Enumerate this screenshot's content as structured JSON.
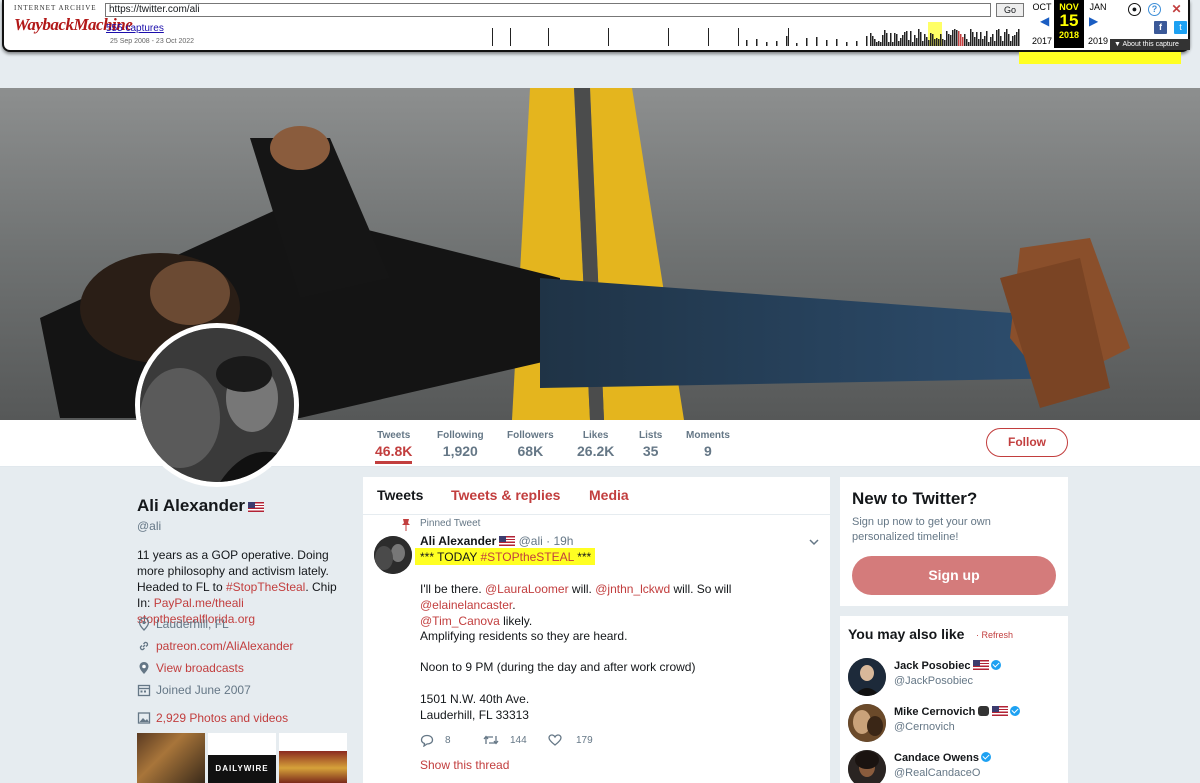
{
  "wayback": {
    "logo_top": "INTERNET ARCHIVE",
    "logo_main": "WaybackMachine",
    "url": "https://twitter.com/ali",
    "go_label": "Go",
    "captures": "555 captures",
    "range": "25 Sep 2008 - 23 Oct 2022",
    "prev_month": "OCT",
    "cur_month": "NOV",
    "cur_day": "15",
    "cur_year": "2018",
    "next_month": "JAN",
    "prev_year": "2017",
    "next_year": "2019",
    "about": "About this capture"
  },
  "profile": {
    "name": "Ali Alexander",
    "handle": "@ali",
    "bio_line1": "11 years as a GOP operative. Doing more philosophy and activism lately. Headed to FL to ",
    "bio_tag": "#StopTheSteal",
    "bio_line2": ". Chip In: ",
    "bio_links": "PayPal.me/theali stopthestealflorida.org",
    "location": "Lauderhill, FL",
    "website": "patreon.com/AliAlexander",
    "broadcasts": "View broadcasts",
    "joined": "Joined June 2007",
    "photos": "2,929 Photos and videos",
    "photo_thumb2_text": "DAILYWIRE"
  },
  "stats": [
    {
      "label": "Tweets",
      "value": "46.8K"
    },
    {
      "label": "Following",
      "value": "1,920"
    },
    {
      "label": "Followers",
      "value": "68K"
    },
    {
      "label": "Likes",
      "value": "26.2K"
    },
    {
      "label": "Lists",
      "value": "35"
    },
    {
      "label": "Moments",
      "value": "9"
    }
  ],
  "follow_label": "Follow",
  "tabs": [
    "Tweets",
    "Tweets & replies",
    "Media"
  ],
  "tweet": {
    "pinned": "Pinned Tweet",
    "name": "Ali Alexander",
    "handle": "@ali",
    "time": "· 19h",
    "line1_a": "*** TODAY ",
    "line1_tag": "#STOPtheSTEAL",
    "line1_b": " ***",
    "p1_a": "I'll be there. ",
    "m1": "@LauraLoomer",
    "p1_b": " will. ",
    "m2": "@jnthn_lckwd",
    "p1_c": " will. So will ",
    "m3": "@elainelancaster",
    "p1_d": ".",
    "m4": "@Tim_Canova",
    "p1_e": " likely.",
    "p2": "Amplifying residents so they are heard.",
    "p3": "Noon to 9 PM (during the day and after work crowd)",
    "p4a": "1501 N.W. 40th Ave.",
    "p4b": "Lauderhill, FL 33313",
    "replies": "8",
    "retweets": "144",
    "likes": "179",
    "show_thread": "Show this thread"
  },
  "newto": {
    "title": "New to Twitter?",
    "sub": "Sign up now to get your own personalized timeline!",
    "signup": "Sign up"
  },
  "ymal": {
    "title": "You may also like",
    "refresh": "· Refresh",
    "items": [
      {
        "name": "Jack Posobiec",
        "handle": "@JackPosobiec"
      },
      {
        "name": "Mike Cernovich",
        "handle": "@Cernovich"
      },
      {
        "name": "Candace Owens",
        "handle": "@RealCandaceO"
      }
    ]
  },
  "colors": {
    "accent": "#c23e3e",
    "signup": "#d47b7b",
    "highlight": "#ffff22"
  }
}
